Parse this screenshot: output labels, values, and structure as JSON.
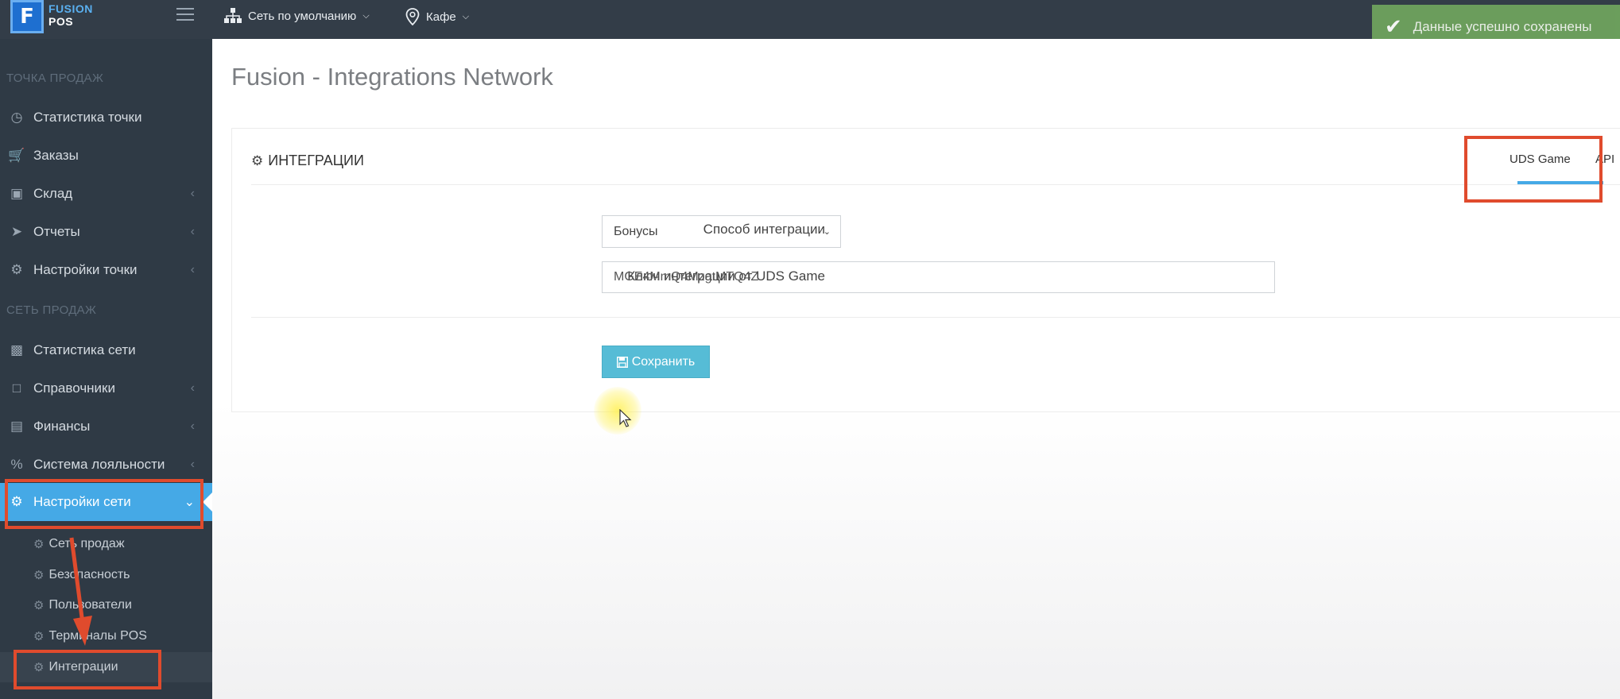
{
  "logo": {
    "letter": "F",
    "line1": "FUSION",
    "line2": "POS"
  },
  "topbar": {
    "network_dropdown": "Сеть по умолчанию",
    "venue_dropdown": "Кафе"
  },
  "toast": {
    "message": "Данные успешно сохранены"
  },
  "sidebar": {
    "section_point": "ТОЧКА ПРОДАЖ",
    "point_items": [
      {
        "label": "Статистика точки",
        "icon": "dashboard-icon"
      },
      {
        "label": "Заказы",
        "icon": "cart-icon"
      },
      {
        "label": "Склад",
        "icon": "inbox-icon"
      },
      {
        "label": "Отчеты",
        "icon": "send-icon"
      },
      {
        "label": "Настройки точки",
        "icon": "gear-icon"
      }
    ],
    "section_network": "СЕТЬ ПРОДАЖ",
    "network_items": [
      {
        "label": "Статистика сети",
        "icon": "bar-chart-icon"
      },
      {
        "label": "Справочники",
        "icon": "folder-icon"
      },
      {
        "label": "Финансы",
        "icon": "money-icon"
      },
      {
        "label": "Система лояльности",
        "icon": "percent-icon"
      },
      {
        "label": "Настройки сети",
        "icon": "gear-icon"
      }
    ],
    "sub_items": [
      {
        "label": "Сеть продаж"
      },
      {
        "label": "Безопасность"
      },
      {
        "label": "Пользователи"
      },
      {
        "label": "Терминалы POS"
      },
      {
        "label": "Интеграции"
      }
    ]
  },
  "main": {
    "page_title": "Fusion - Integrations Network",
    "panel_title": "ИНТЕГРАЦИИ",
    "tabs": [
      {
        "label": "UDS Game",
        "active": true
      },
      {
        "label": "API",
        "active": false
      }
    ],
    "form": {
      "method_label": "Способ интеграции",
      "method_value": "Бонусы",
      "key_label": "Ключ интеграции от UDS Game",
      "key_value": "MGE4MmQ4MzgtMTQ4Z"
    },
    "save_button": "Сохранить"
  },
  "colors": {
    "sidebar_bg": "#2f3a45",
    "accent": "#45a9e6",
    "save_button": "#56bcd6",
    "toast_bg": "#6fa35e",
    "highlight": "#e04b2d"
  }
}
